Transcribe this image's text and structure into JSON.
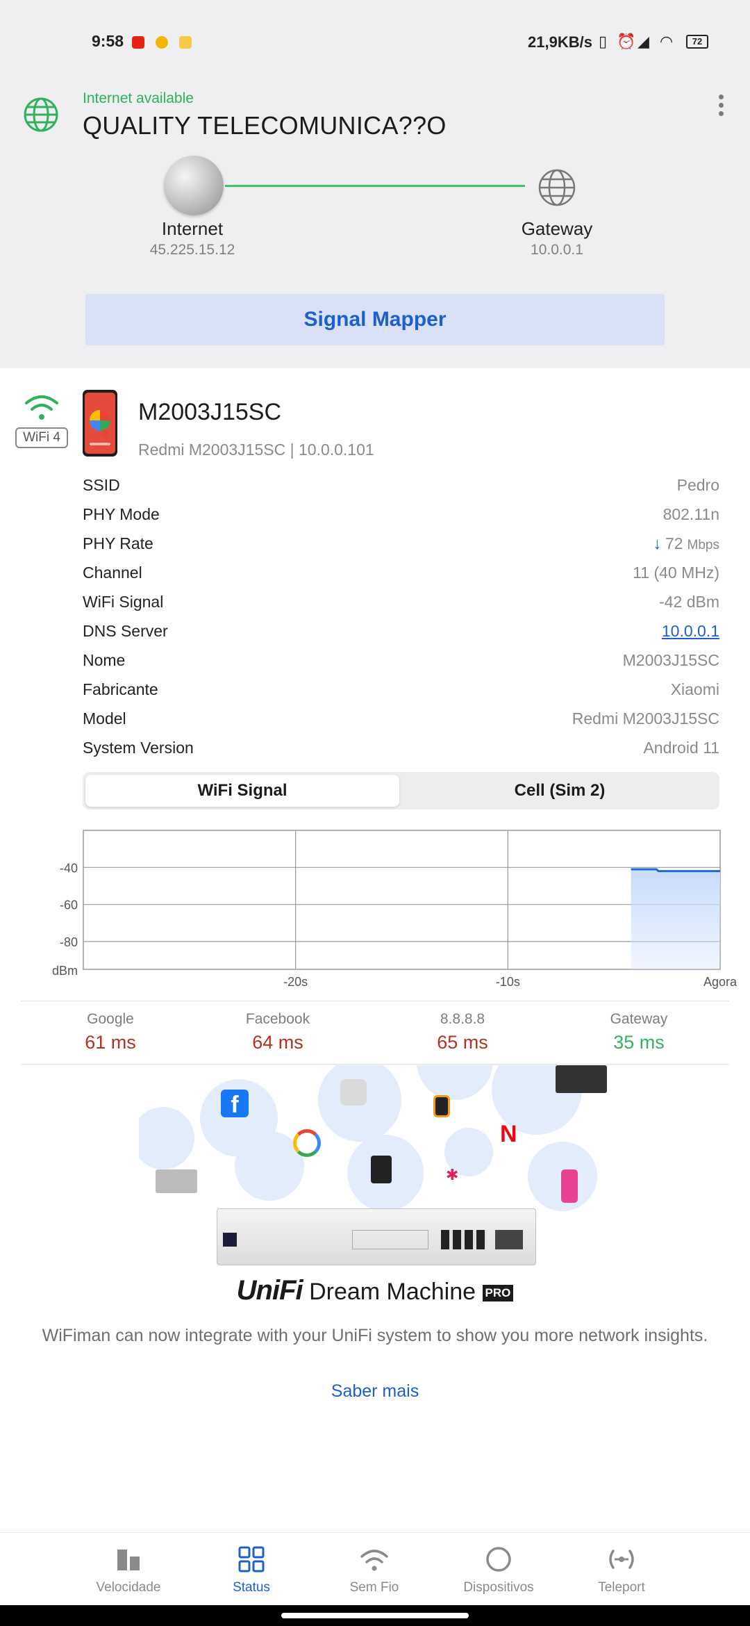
{
  "status_bar": {
    "time": "9:58",
    "speed": "21,9KB/s",
    "battery": "72"
  },
  "header": {
    "connection_status": "Internet available",
    "isp_name": "QUALITY TELECOMUNICA??O",
    "internet_label": "Internet",
    "internet_ip": "45.225.15.12",
    "gateway_label": "Gateway",
    "gateway_ip": "10.0.0.1",
    "signal_mapper_label": "Signal Mapper"
  },
  "device": {
    "wifi_badge": "WiFi 4",
    "name": "M2003J15SC",
    "subtitle": "Redmi M2003J15SC | 10.0.0.101",
    "rows": [
      {
        "label": "SSID",
        "value": "Pedro"
      },
      {
        "label": "PHY Mode",
        "value": "802.11n"
      },
      {
        "label": "PHY Rate",
        "arrow": "↓",
        "value": "72",
        "unit": "Mbps"
      },
      {
        "label": "Channel",
        "value": "11 (40 MHz)"
      },
      {
        "label": "WiFi Signal",
        "value": "-42 dBm"
      },
      {
        "label": "DNS Server",
        "value": "10.0.0.1"
      },
      {
        "label": "Nome",
        "value": "M2003J15SC"
      },
      {
        "label": "Fabricante",
        "value": "Xiaomi"
      },
      {
        "label": "Model",
        "value": "Redmi M2003J15SC"
      },
      {
        "label": "System Version",
        "value": "Android 11"
      }
    ]
  },
  "tabs": {
    "wifi_signal": "WiFi Signal",
    "cell": "Cell (Sim 2)"
  },
  "chart_data": {
    "type": "area",
    "ylabel": "dBm",
    "y_ticks": [
      "-40",
      "-60",
      "-80"
    ],
    "x_ticks": [
      "-20s",
      "-10s",
      "Agora"
    ],
    "ylim": [
      -95,
      -20
    ],
    "xlim": [
      -30,
      0
    ],
    "grid": true,
    "series": [
      {
        "x": [
          -4.2,
          -3.0,
          -2.9,
          0
        ],
        "y": [
          -41,
          -41,
          -42,
          -42
        ]
      }
    ],
    "colors": {
      "line": "#1c6ad8",
      "fill": "#c7dcfb"
    }
  },
  "pings": [
    {
      "label": "Google",
      "value": "61 ms",
      "status": "bad"
    },
    {
      "label": "Facebook",
      "value": "64 ms",
      "status": "bad"
    },
    {
      "label": "8.8.8.8",
      "value": "65 ms",
      "status": "bad"
    },
    {
      "label": "Gateway",
      "value": "35 ms",
      "status": "good"
    }
  ],
  "promo": {
    "logo_unifi": "UniFi",
    "logo_product": "Dream Machine",
    "logo_badge": "PRO",
    "text": "WiFiman can now integrate with your UniFi system to show you more network insights.",
    "link": "Saber mais"
  },
  "nav": [
    {
      "label": "Velocidade",
      "icon": "speed-bars-icon",
      "active": false
    },
    {
      "label": "Status",
      "icon": "grid-icon",
      "active": true
    },
    {
      "label": "Sem Fio",
      "icon": "wifi-icon",
      "active": false
    },
    {
      "label": "Dispositivos",
      "icon": "circle-icon",
      "active": false
    },
    {
      "label": "Teleport",
      "icon": "teleport-icon",
      "active": false
    }
  ],
  "colors": {
    "accent": "#1c5fd1",
    "good": "#35b25e",
    "bad": "#b3321f",
    "header_bg": "#efeff1"
  }
}
